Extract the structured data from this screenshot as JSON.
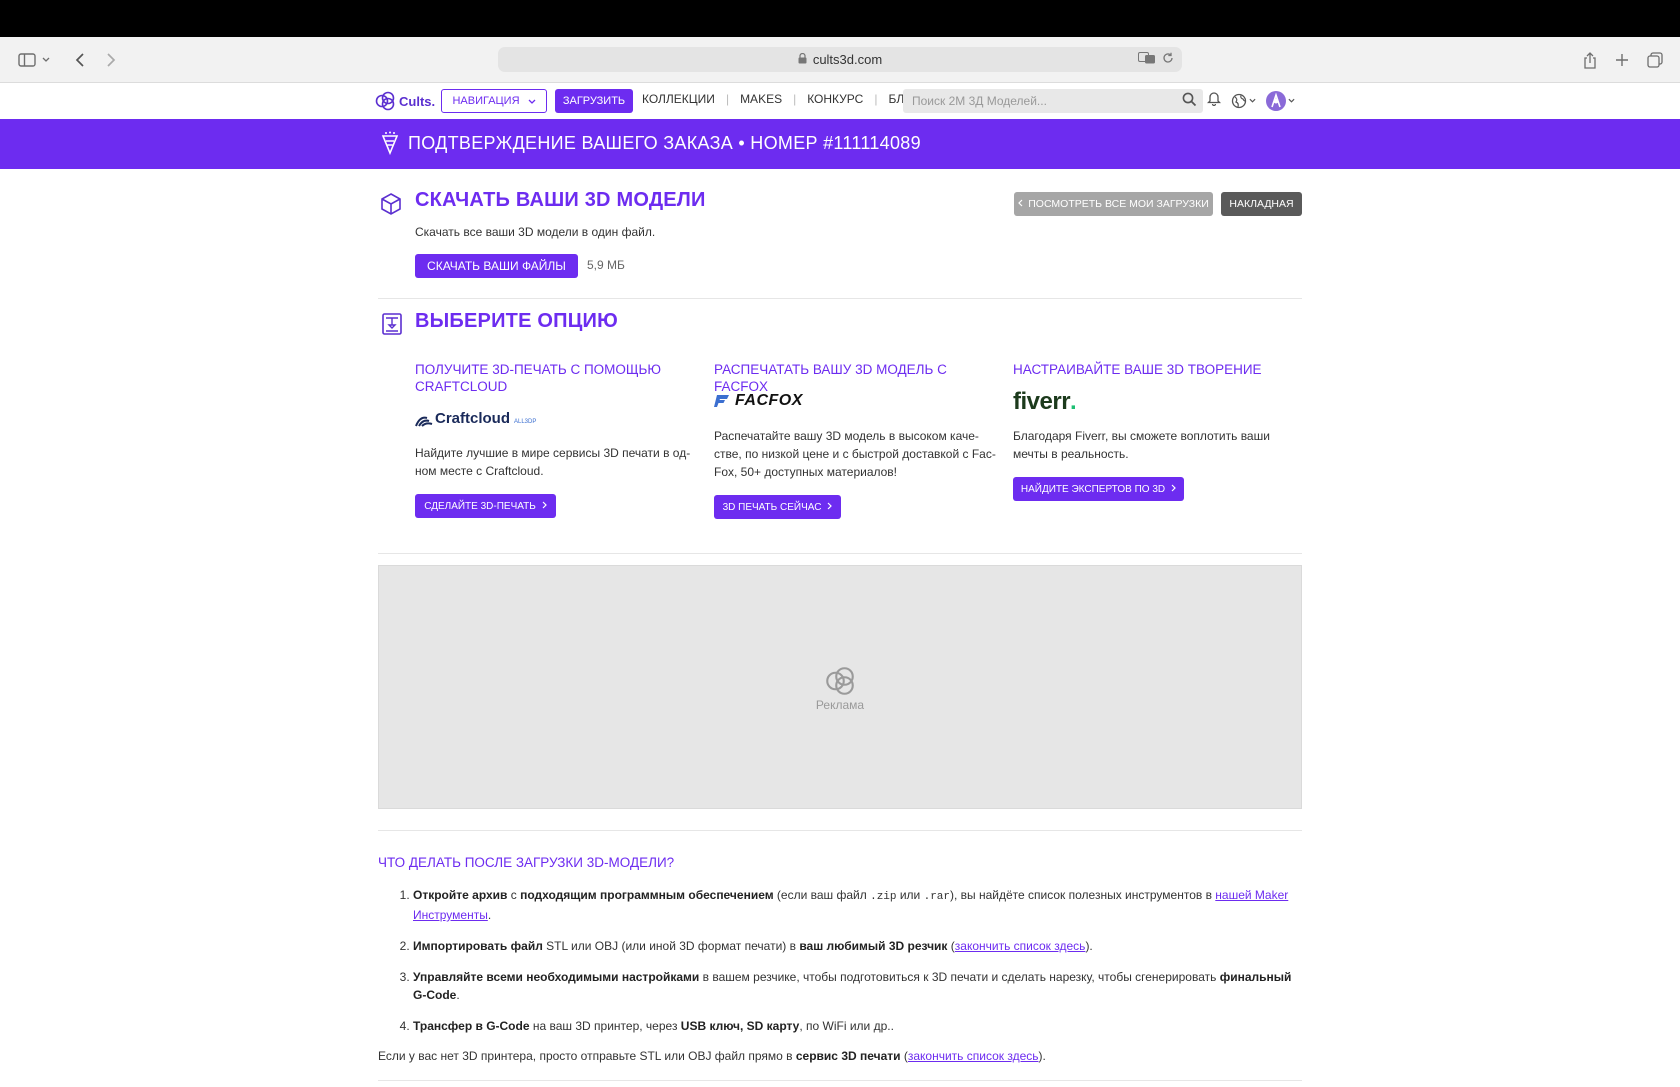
{
  "browser": {
    "url": "cults3d.com",
    "icons": [
      "sidebar-icon",
      "chevron-down-icon",
      "back-icon",
      "forward-icon",
      "lock-icon",
      "translate-icon",
      "reload-icon",
      "share-icon",
      "new-tab-icon",
      "tabs-icon"
    ]
  },
  "nav": {
    "logo": "Cults.",
    "navigation_label": "НАВИГАЦИЯ",
    "upload_label": "ЗАГРУЗИТЬ",
    "links": [
      "КОЛЛЕКЦИИ",
      "MAKES",
      "КОНКУРС",
      "БЛОГ"
    ],
    "search_placeholder": "Поиск 2M 3Д Моделей..."
  },
  "banner": {
    "title": "ПОДТВЕРЖДЕНИЕ ВАШЕГО ЗАКАЗА • НОМЕР #111114089"
  },
  "download": {
    "title": "СКАЧАТЬ ВАШИ 3D МОДЕЛИ",
    "description": "Скачать все ваши 3D модели в один файл.",
    "button": "СКАЧАТЬ ВАШИ ФАЙЛЫ",
    "size": "5,9 МБ",
    "view_all_button": "ПОСМОТРЕТЬ ВСЕ МОИ ЗАГРУЗКИ",
    "invoice_button": "НАКЛАДНАЯ"
  },
  "options": {
    "title": "ВЫБЕРИТЕ ОПЦИЮ",
    "items": [
      {
        "title": "ПОЛУЧИТЕ 3D-ПЕЧАТЬ С ПОМОЩЬЮ CRAFTCLOUD",
        "brand": "Craftcloud",
        "brand_sub": "ALL3DP",
        "description": "Найдите лучшие в мире сервисы 3D печати в од­ном месте с Craftcloud.",
        "button": "СДЕЛАЙТЕ 3D-ПЕЧАТЬ"
      },
      {
        "title": "РАСПЕЧАТАТЬ ВАШУ 3D МОДЕЛЬ С FACFOX",
        "brand": "FACFOX",
        "description": "Распечатайте вашу 3D модель в высоком каче­стве, по низкой цене и с быстрой доставкой с Fac­Fox, 50+ доступных материалов!",
        "button": "3D ПЕЧАТЬ СЕЙЧАС"
      },
      {
        "title": "НАСТРАИВАЙТЕ ВАШЕ 3D ТВОРЕНИЕ",
        "brand": "fiverr",
        "brand_dot": ".",
        "description": "Благодаря Fiverr, вы сможете воплотить ваши мечты в реальность.",
        "button": "НАЙДИТЕ ЭКСПЕРТОВ ПО 3D"
      }
    ]
  },
  "ad": {
    "label": "Реклама"
  },
  "faq": {
    "title": "ЧТО ДЕЛАТЬ ПОСЛЕ ЗАГРУЗКИ 3D-МОДЕЛИ?",
    "step1": {
      "b1": "Откройте архив",
      "t1": " с ",
      "b2": "подходящим программным обеспечением",
      "t2": " (если ваш файл ",
      "c1": ".zip",
      "t3": " или ",
      "c2": ".rar",
      "t4": "), вы найдёте список полезных инструментов в ",
      "link": "нашей Maker Инструменты",
      "t5": "."
    },
    "step2": {
      "b1": "Импортировать файл",
      "t1": " STL или OBJ (или иной 3D формат печати) в ",
      "b2": "ваш любимый 3D резчик",
      "t2": " (",
      "link": "закончить список здесь",
      "t3": ")."
    },
    "step3": {
      "b1": "Управляйте всеми необходимыми настройками",
      "t1": " в вашем резчике, чтобы подготовиться к 3D печати и сделать нарезку, чтобы сгенерировать ",
      "b2": "финаль­ный G-Code",
      "t2": "."
    },
    "step4": {
      "b1": "Трансфер в G-Code",
      "t1": " на ваш 3D принтер, через ",
      "b2": "USB ключ, SD карту",
      "t2": ", по WiFi или др.."
    },
    "footer": {
      "t1": "Если у вас нет 3D принтера, просто отправьте STL или OBJ файл прямо в ",
      "b1": "сервис 3D печати",
      "t2": " (",
      "link": "закончить список здесь",
      "t3": ")."
    }
  },
  "colors": {
    "accent": "#6d2cf0",
    "banner": "#6d2cf0",
    "fiverr": "#1dbf73"
  }
}
